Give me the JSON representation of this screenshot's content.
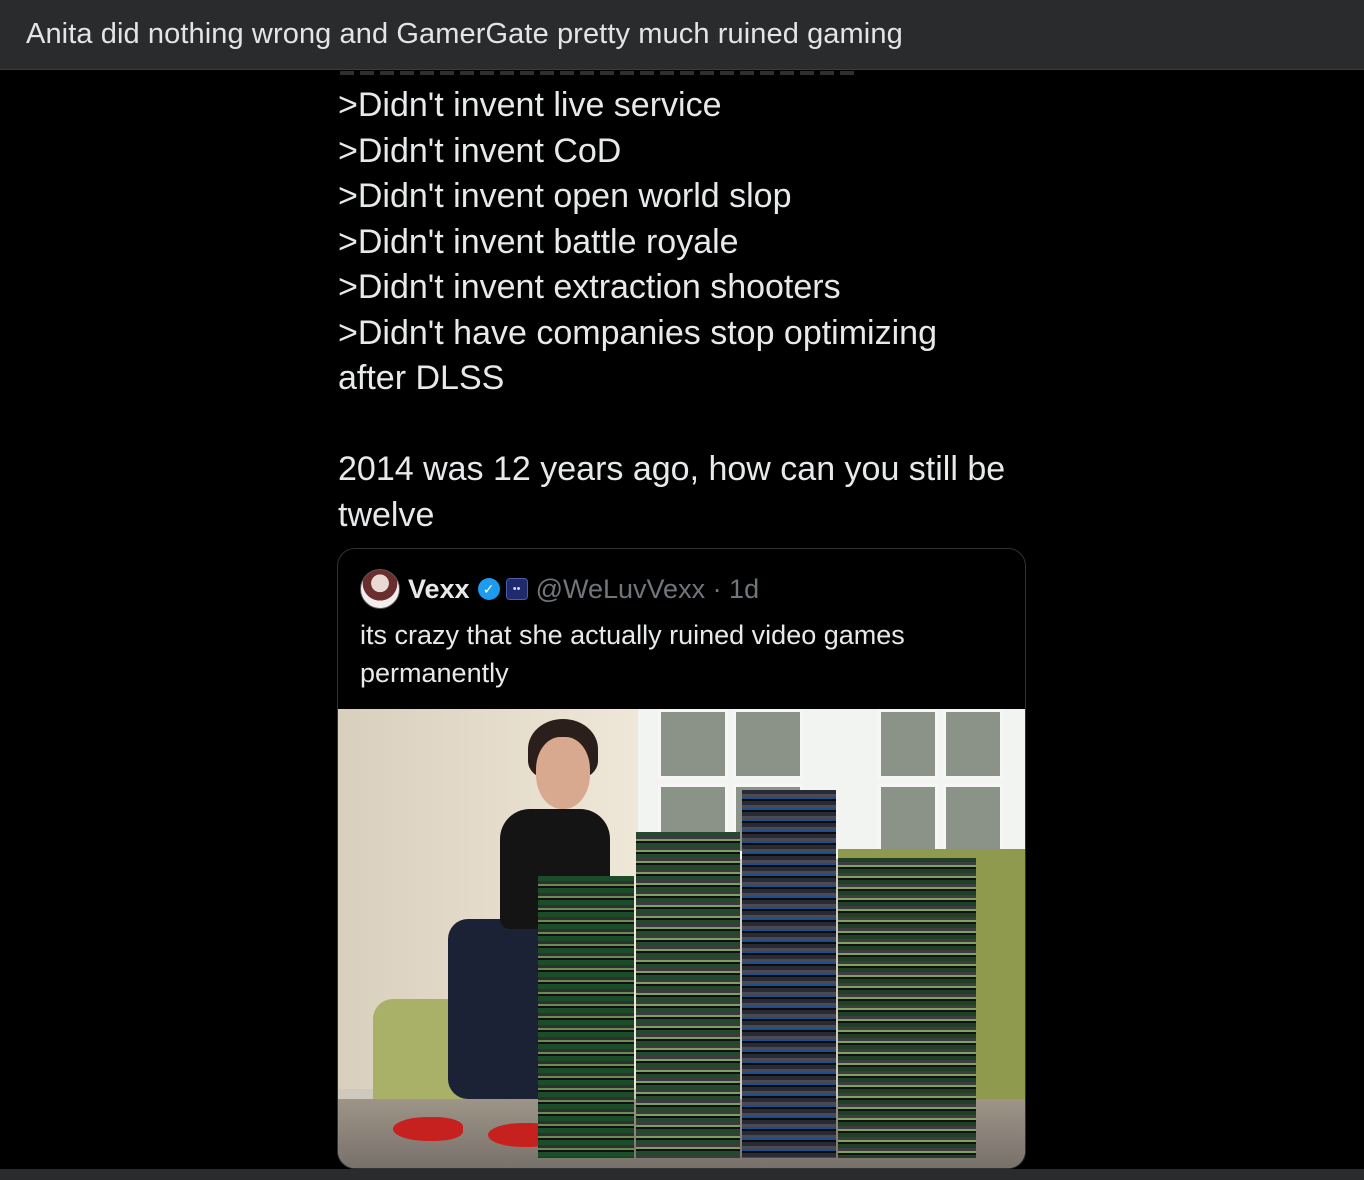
{
  "window": {
    "title": "Anita did nothing wrong and GamerGate pretty much ruined gaming"
  },
  "post": {
    "lines": [
      ">Didn't invent live service",
      ">Didn't invent CoD",
      ">Didn't invent open world slop",
      ">Didn't invent battle royale",
      ">Didn't invent extraction shooters",
      ">Didn't have companies stop optimizing",
      "after DLSS"
    ],
    "closing_lines": [
      "2014 was 12 years ago, how can you still be",
      "twelve"
    ]
  },
  "quote": {
    "name": "Vexx",
    "handle": "@WeLuvVexx · 1d",
    "text_lines": [
      "its crazy that she actually ruined video games",
      "permanently"
    ],
    "verified_icon": "verified-badge-icon",
    "affiliate_icon": "affiliate-badge-icon",
    "photo": "woman-with-game-stacks-photo"
  },
  "colors": {
    "background": "#000000",
    "title_bar": "#2a2b2d",
    "text": "#e7e9ea",
    "muted": "#71767b",
    "verified": "#1d9bf0"
  }
}
